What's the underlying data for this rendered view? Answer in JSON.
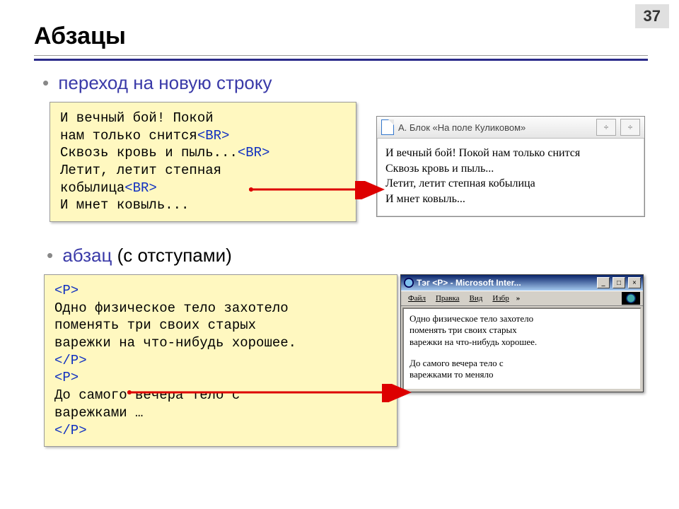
{
  "pageNumber": "37",
  "title": "Абзацы",
  "bullets": {
    "first": "переход на новую строку",
    "secondWord": "абзац",
    "secondParen": "(с отступами)"
  },
  "code1": {
    "l1": "И вечный бой! Покой",
    "l2a": "нам только снится",
    "l2b": "<BR>",
    "l3a": "Сквозь кровь и пыль...",
    "l3b": "<BR>",
    "l4": "Летит, летит степная",
    "l5a": "кобылица",
    "l5b": "<BR>",
    "l6": "И мнет ковыль..."
  },
  "browser1": {
    "title": "А. Блок  «На поле Куликовом»",
    "btn1": "÷",
    "btn2": "÷",
    "line1": "И вечный бой! Покой нам только снится",
    "line2": "Сквозь кровь и пыль...",
    "line3": "Летит, летит степная кобылица",
    "line4": "И мнет ковыль..."
  },
  "code2": {
    "t1": "<P>",
    "l1": "Одно физическое тело захотело",
    "l2": "поменять три своих старых",
    "l3": "варежки на что-нибудь хорошее.",
    "t2": "</P>",
    "t3": "<P>",
    "l4": "До самого вечера тело с",
    "l5": "варежками …",
    "t4": "</P>"
  },
  "ie": {
    "title": "Тэг <P> - Microsoft Inter...",
    "menus": {
      "m1": "Файл",
      "m2": "Правка",
      "m3": "Вид",
      "m4": "Избр"
    },
    "chevrons": "»",
    "ctrlMin": "_",
    "ctrlMax": "□",
    "ctrlClose": "×",
    "p1l1": "Одно физическое тело захотело",
    "p1l2": "поменять три своих старых",
    "p1l3": "варежки на что-нибудь хорошее.",
    "p2l1": "До самого вечера тело с",
    "p2l2": "варежками то меняло"
  }
}
